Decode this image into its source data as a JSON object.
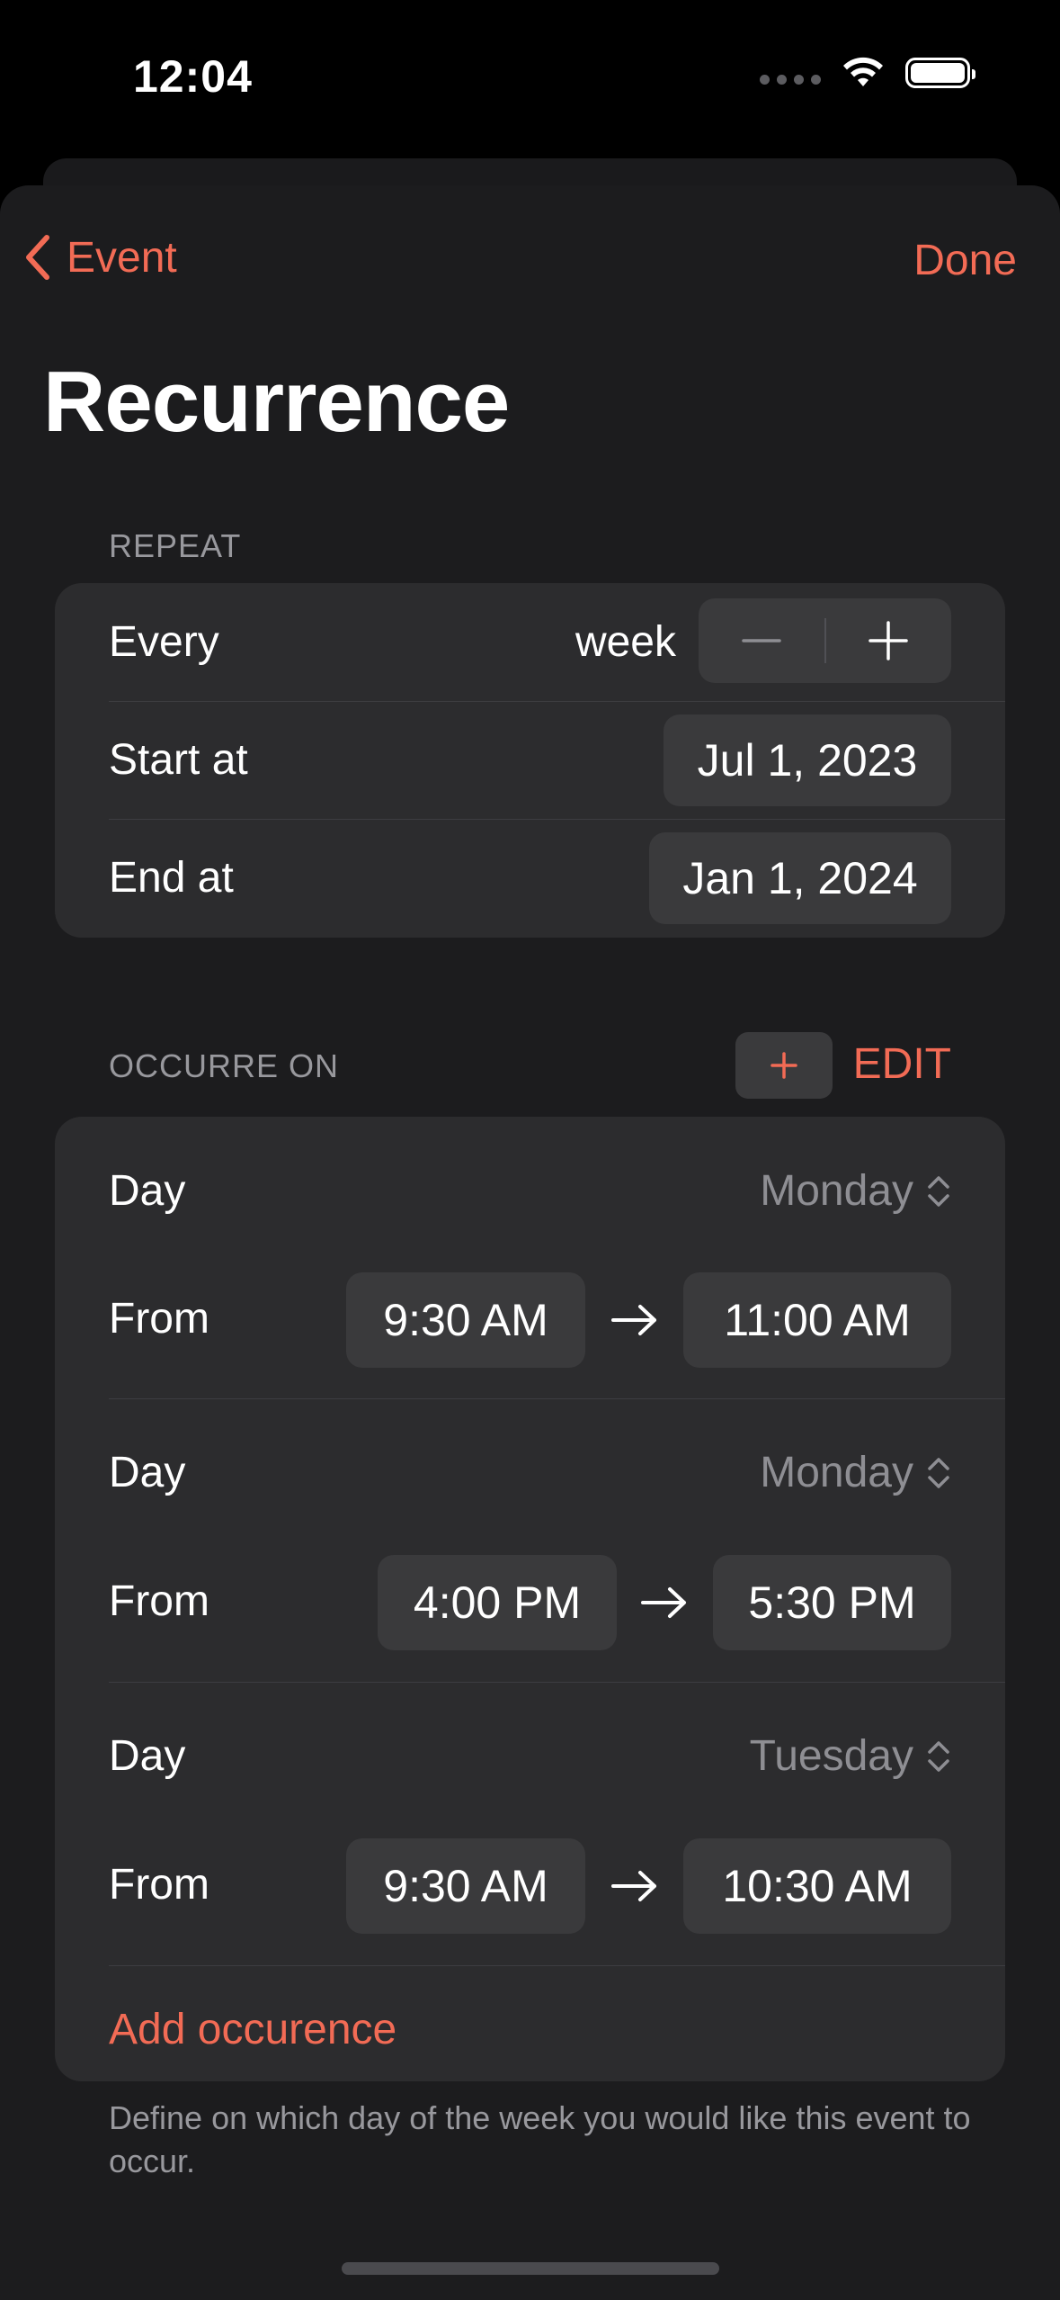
{
  "status_bar": {
    "time": "12:04"
  },
  "nav": {
    "back_label": "Event",
    "done_label": "Done"
  },
  "page_title": "Recurrence",
  "repeat": {
    "header": "REPEAT",
    "every_label": "Every",
    "every_unit": "week",
    "start_label": "Start at",
    "start_value": "Jul 1, 2023",
    "end_label": "End at",
    "end_value": "Jan 1, 2024"
  },
  "occurrences": {
    "header": "OCCURRE ON",
    "edit_label": "EDIT",
    "items": [
      {
        "day_label": "Day",
        "day": "Monday",
        "from_label": "From",
        "start": "9:30 AM",
        "end": "11:00 AM"
      },
      {
        "day_label": "Day",
        "day": "Monday",
        "from_label": "From",
        "start": "4:00 PM",
        "end": "5:30 PM"
      },
      {
        "day_label": "Day",
        "day": "Tuesday",
        "from_label": "From",
        "start": "9:30 AM",
        "end": "10:30 AM"
      }
    ],
    "add_label": "Add occurence",
    "footer": "Define on which day of the week you would like this event to occur."
  },
  "colors": {
    "accent": "#f26b55",
    "background": "#1c1c1e",
    "card": "#2c2c2e",
    "pill": "#3a3a3c"
  },
  "icons": [
    "wifi-icon",
    "battery-icon",
    "chevron-left-icon",
    "minus-icon",
    "plus-icon",
    "chevron-updown-icon",
    "arrow-right-icon"
  ]
}
